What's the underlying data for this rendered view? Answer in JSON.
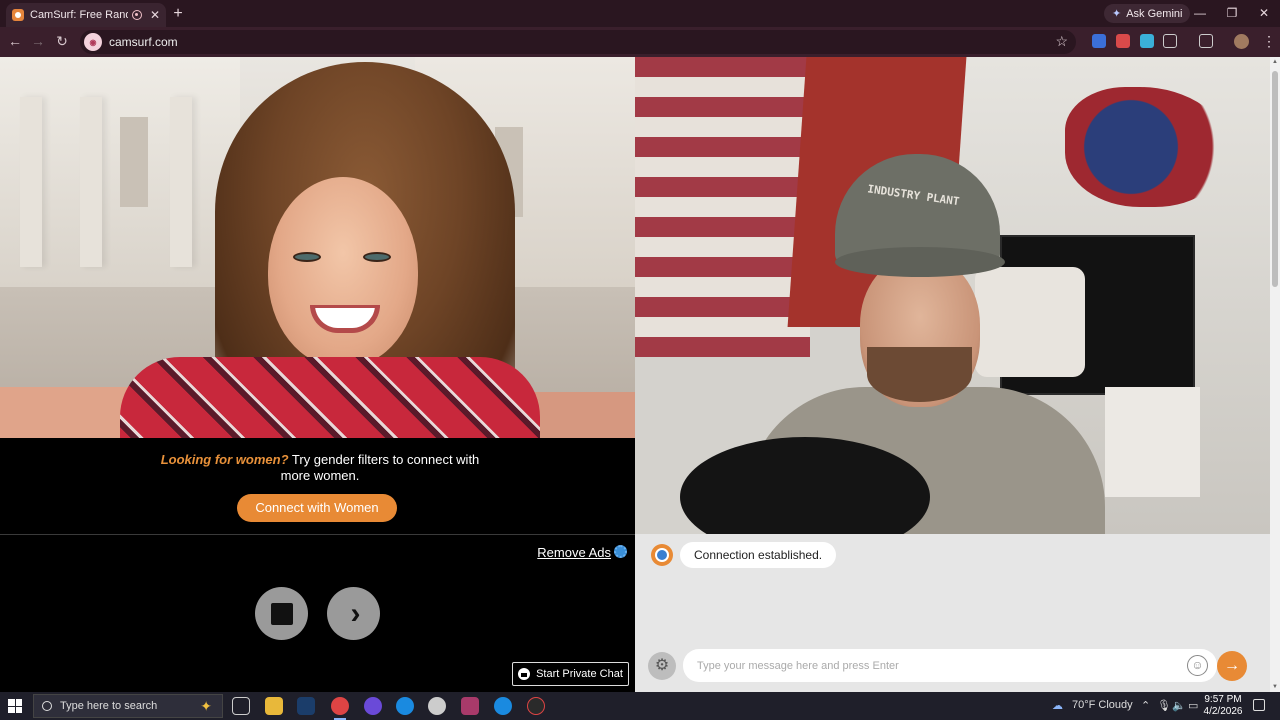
{
  "browser": {
    "tab_title": "CamSurf: Free Random Video",
    "tab_close": "✕",
    "new_tab": "+",
    "ask_gemini": "Ask Gemini",
    "url": "camsurf.com",
    "window_buttons": [
      "—",
      "❐",
      "✕"
    ]
  },
  "promo": {
    "highlight": "Looking for women?",
    "text": "Try gender filters to connect with more women.",
    "button": "Connect with Women"
  },
  "controls": {
    "remove_ads": "Remove Ads",
    "private_chat": "Start Private Chat"
  },
  "right_video": {
    "cap_text": "INDUSTRY PLANT"
  },
  "chat": {
    "message": "Connection established.",
    "input_placeholder": "Type your message here and press Enter",
    "send_arrow": "→",
    "emoji": "☺",
    "settings": "⚙"
  },
  "taskbar": {
    "search_placeholder": "Type here to search",
    "weather": "70°F  Cloudy",
    "time": "9:57 PM",
    "date": "4/2/2026"
  },
  "colors": {
    "accent": "#e88a35",
    "chrome": "#3a1f2c"
  }
}
